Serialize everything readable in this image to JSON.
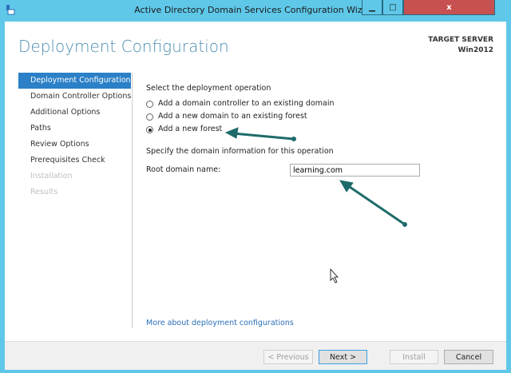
{
  "window": {
    "title": "Active Directory Domain Services Configuration Wizard",
    "minimize": "▁",
    "maximize": "□",
    "close": "x"
  },
  "header": {
    "title": "Deployment Configuration",
    "target_label": "TARGET SERVER",
    "target_value": "Win2012"
  },
  "sidebar": {
    "items": [
      {
        "label": "Deployment Configuration",
        "state": "selected"
      },
      {
        "label": "Domain Controller Options",
        "state": "enabled"
      },
      {
        "label": "Additional Options",
        "state": "enabled"
      },
      {
        "label": "Paths",
        "state": "enabled"
      },
      {
        "label": "Review Options",
        "state": "enabled"
      },
      {
        "label": "Prerequisites Check",
        "state": "enabled"
      },
      {
        "label": "Installation",
        "state": "disabled"
      },
      {
        "label": "Results",
        "state": "disabled"
      }
    ]
  },
  "main": {
    "operation_label": "Select the deployment operation",
    "options": [
      {
        "label": "Add a domain controller to an existing domain",
        "checked": false
      },
      {
        "label": "Add a new domain to an existing forest",
        "checked": false
      },
      {
        "label": "Add a new forest",
        "checked": true
      }
    ],
    "domain_info_label": "Specify the domain information for this operation",
    "root_domain_label": "Root domain name:",
    "root_domain_value": "learning.com",
    "more_link": "More about deployment configurations"
  },
  "footer": {
    "previous": "< Previous",
    "next": "Next >",
    "install": "Install",
    "cancel": "Cancel"
  },
  "colors": {
    "accent": "#2b80c7",
    "frame": "#5fc8e9",
    "annotation_arrow": "#1f6b6b"
  }
}
